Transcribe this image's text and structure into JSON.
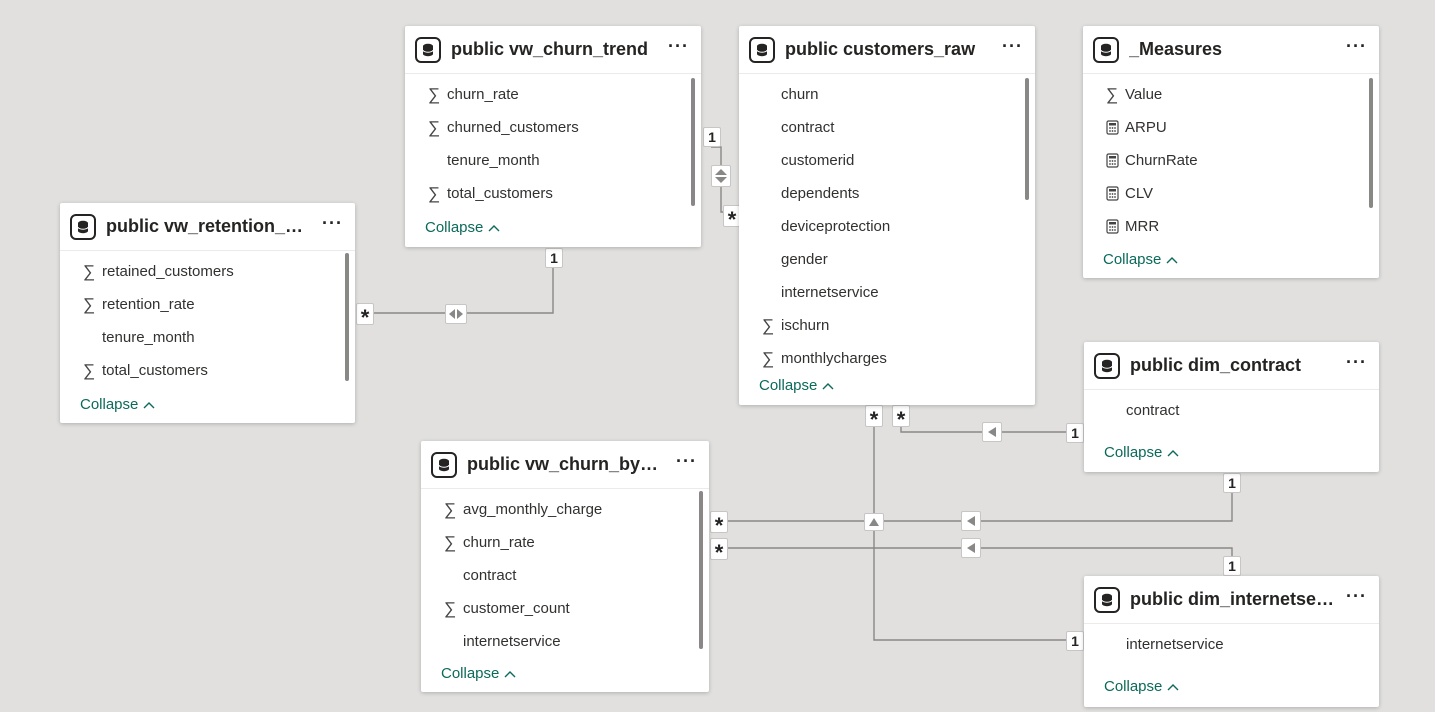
{
  "tables": {
    "vw_churn_trend": {
      "title": "public vw_churn_trend",
      "fields": [
        {
          "label": "churn_rate",
          "icon": "sigma-icon"
        },
        {
          "label": "churned_customers",
          "icon": "sigma-icon"
        },
        {
          "label": "tenure_month",
          "icon": ""
        },
        {
          "label": "total_customers",
          "icon": "sigma-icon"
        }
      ],
      "collapse": "Collapse"
    },
    "customers_raw": {
      "title": "public customers_raw",
      "fields": [
        {
          "label": "churn",
          "icon": ""
        },
        {
          "label": "contract",
          "icon": ""
        },
        {
          "label": "customerid",
          "icon": ""
        },
        {
          "label": "dependents",
          "icon": ""
        },
        {
          "label": "deviceprotection",
          "icon": ""
        },
        {
          "label": "gender",
          "icon": ""
        },
        {
          "label": "internetservice",
          "icon": ""
        },
        {
          "label": "ischurn",
          "icon": "sigma-icon"
        },
        {
          "label": "monthlycharges",
          "icon": "sigma-icon"
        }
      ],
      "collapse": "Collapse"
    },
    "measures": {
      "title": "_Measures",
      "fields": [
        {
          "label": "Value",
          "icon": "sigma-icon"
        },
        {
          "label": "ARPU",
          "icon": "calculator-icon"
        },
        {
          "label": "ChurnRate",
          "icon": "calculator-icon"
        },
        {
          "label": "CLV",
          "icon": "calculator-icon"
        },
        {
          "label": "MRR",
          "icon": "calculator-icon"
        }
      ],
      "collapse": "Collapse"
    },
    "vw_retention": {
      "title": "public vw_retention_by_...",
      "fields": [
        {
          "label": "retained_customers",
          "icon": "sigma-icon"
        },
        {
          "label": "retention_rate",
          "icon": "sigma-icon"
        },
        {
          "label": "tenure_month",
          "icon": ""
        },
        {
          "label": "total_customers",
          "icon": "sigma-icon"
        }
      ],
      "collapse": "Collapse"
    },
    "dim_contract": {
      "title": "public dim_contract",
      "fields": [
        {
          "label": "contract",
          "icon": ""
        }
      ],
      "collapse": "Collapse"
    },
    "vw_churn_by_se": {
      "title": "public vw_churn_by_se...",
      "fields": [
        {
          "label": "avg_monthly_charge",
          "icon": "sigma-icon"
        },
        {
          "label": "churn_rate",
          "icon": "sigma-icon"
        },
        {
          "label": "contract",
          "icon": ""
        },
        {
          "label": "customer_count",
          "icon": "sigma-icon"
        },
        {
          "label": "internetservice",
          "icon": ""
        }
      ],
      "collapse": "Collapse"
    },
    "dim_internetservice": {
      "title": "public dim_internetserv...",
      "fields": [
        {
          "label": "internetservice",
          "icon": ""
        }
      ],
      "collapse": "Collapse"
    }
  },
  "cardinality": {
    "one": "1",
    "many": "*"
  },
  "more_menu": "···",
  "colors": {
    "canvas": "#e1e0df",
    "line": "#8a8886",
    "collapse": "#0b6a5a"
  }
}
